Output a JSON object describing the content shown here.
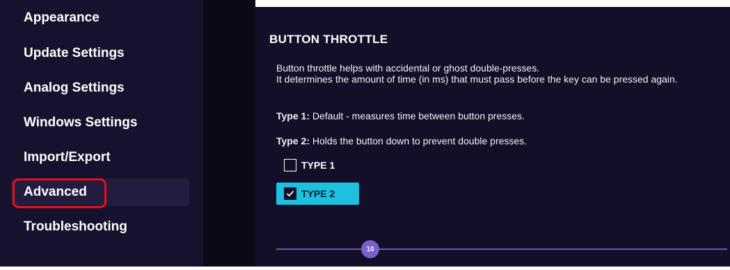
{
  "sidebar": {
    "items": [
      {
        "label": "Appearance"
      },
      {
        "label": "Update Settings"
      },
      {
        "label": "Analog Settings"
      },
      {
        "label": "Windows Settings"
      },
      {
        "label": "Import/Export"
      },
      {
        "label": "Advanced",
        "active": true
      },
      {
        "label": "Troubleshooting"
      }
    ]
  },
  "section": {
    "title": "BUTTON THROTTLE",
    "description_line1": "Button throttle helps with accidental or ghost double-presses.",
    "description_line2": "It determines the amount of time (in ms) that must pass before the key can be pressed again.",
    "type1_label": "Type 1:",
    "type1_text": " Default - measures time between button presses.",
    "type2_label": "Type 2:",
    "type2_text": " Holds the button down to prevent double presses."
  },
  "options": [
    {
      "label": "TYPE 1",
      "checked": false
    },
    {
      "label": "TYPE 2",
      "checked": true
    }
  ],
  "slider": {
    "value": "10"
  },
  "colors": {
    "sidebar_bg": "#16112d",
    "main_bg": "#130f28",
    "accent": "#1ec0e0",
    "slider": "#7a60c9",
    "highlight": "#e8101a"
  },
  "icons": {
    "check": "check-icon"
  }
}
